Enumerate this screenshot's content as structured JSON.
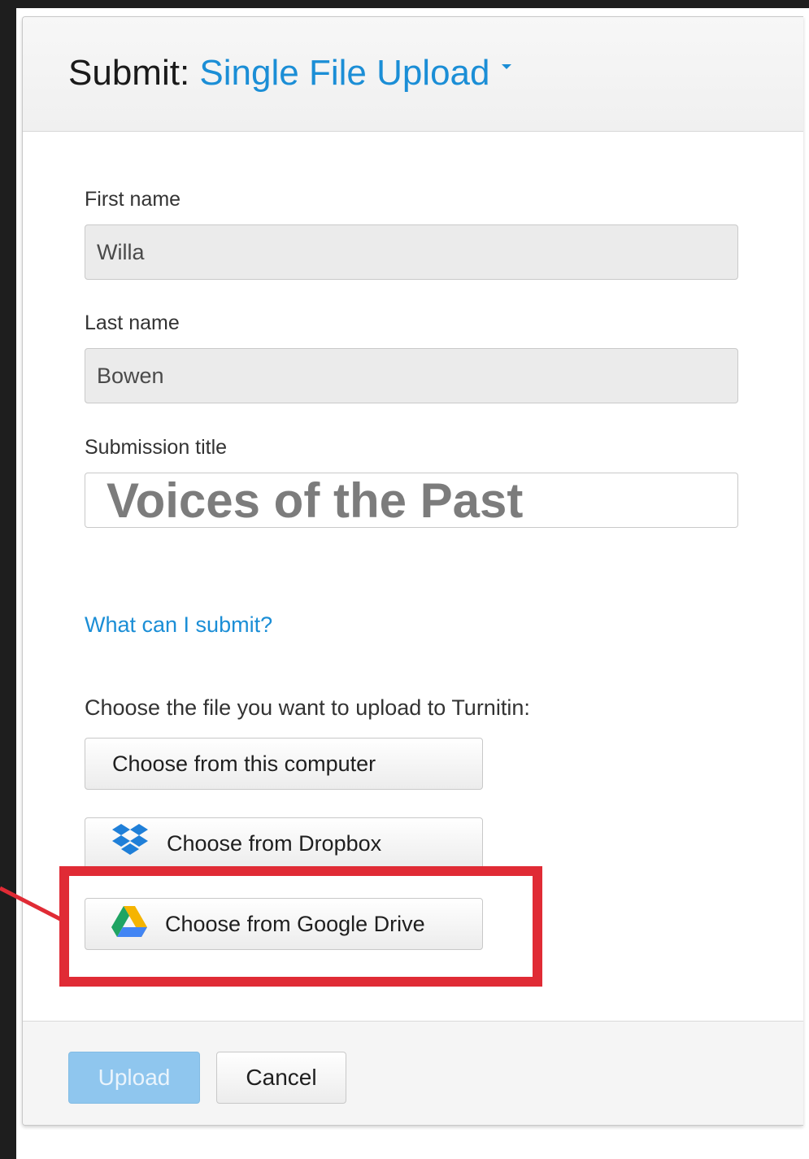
{
  "header": {
    "prefix": "Submit:",
    "submission_type": "Single File Upload"
  },
  "form": {
    "first_name": {
      "label": "First name",
      "value": "Willa"
    },
    "last_name": {
      "label": "Last name",
      "value": "Bowen"
    },
    "submission_title": {
      "label": "Submission title",
      "value": "Voices of the Past"
    }
  },
  "help_link": "What can I submit?",
  "choose_prompt": "Choose the file you want to upload to Turnitin:",
  "sources": {
    "computer": "Choose from this computer",
    "dropbox": "Choose from Dropbox",
    "google_drive": "Choose from Google Drive"
  },
  "footer": {
    "upload": "Upload",
    "cancel": "Cancel"
  },
  "colors": {
    "link": "#1b8ed6",
    "highlight": "#e02b35",
    "upload_disabled": "#8fc6ee"
  },
  "icons": {
    "dropbox": "dropbox-icon",
    "google_drive": "google-drive-icon",
    "dropdown": "caret-down-icon"
  }
}
